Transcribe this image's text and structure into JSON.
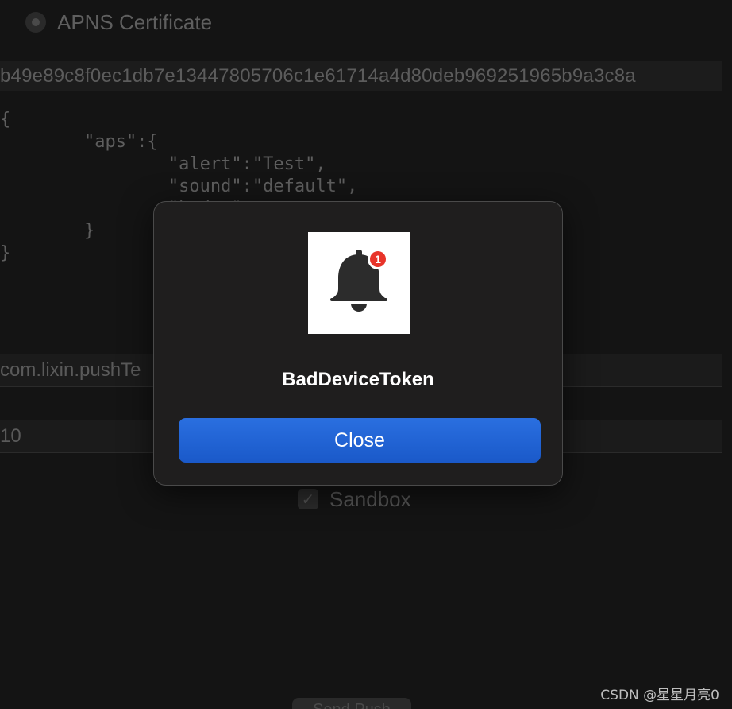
{
  "background": {
    "auth_option_label": "APNS Certificate",
    "device_token": "b49e89c8f0ec1db7e13447805706c1e61714a4d80deb969251965b9a3c8a",
    "payload_lines": [
      "{",
      "        \"aps\":{",
      "                \"alert\":\"Test\",",
      "                \"sound\":\"default\",",
      "                \"badge\"",
      "        }",
      "}"
    ],
    "topic_value": "com.lixin.pushTe",
    "priority_value": "10",
    "sandbox_label": "Sandbox",
    "sandbox_checked": true,
    "bottom_button_label": "Send Push"
  },
  "alert": {
    "icon": "bell-badge-icon",
    "badge_count": "1",
    "title": "BadDeviceToken",
    "close_label": "Close"
  },
  "watermark": "CSDN @星星月亮0",
  "colors": {
    "accent": "#1f63d6",
    "badge": "#e8342a",
    "dialog_bg": "#1f1e1e"
  }
}
